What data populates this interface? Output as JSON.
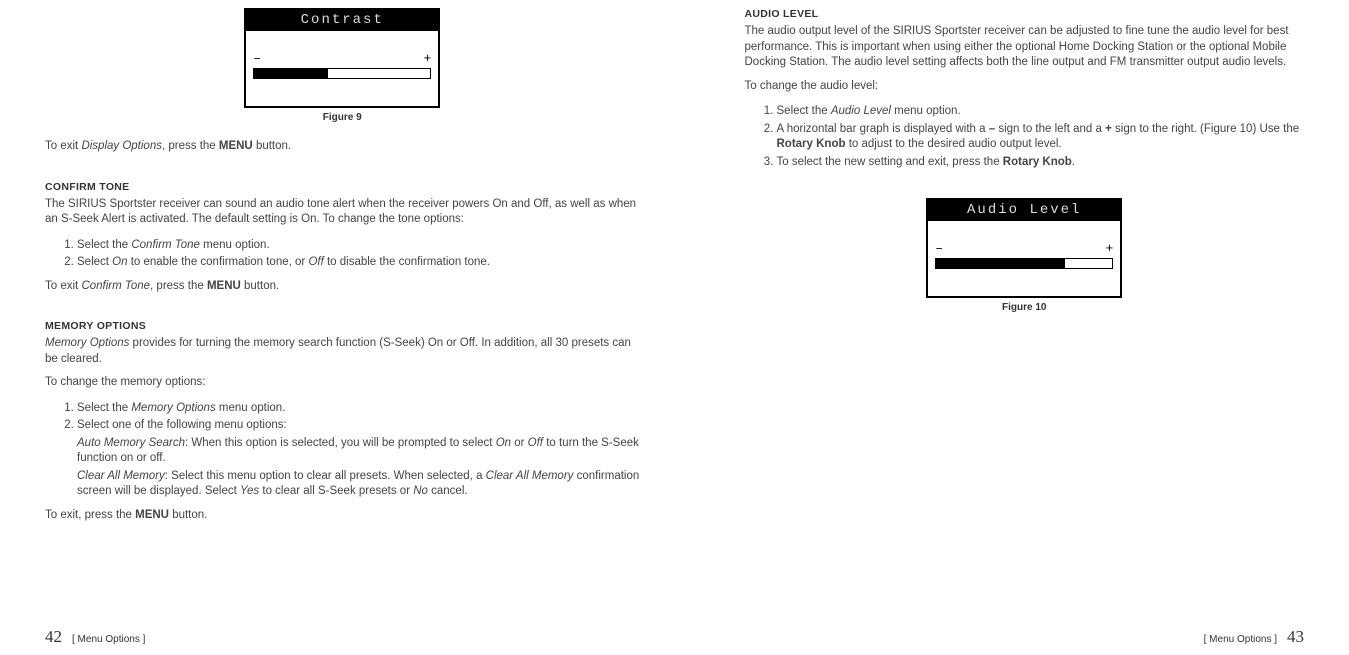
{
  "leftPage": {
    "lcd": {
      "title": "Contrast",
      "minus": "–",
      "plus": "+",
      "fillPercent": 42
    },
    "figureCaption": "Figure 9",
    "exitDisplay": {
      "prefix": "To exit ",
      "italic": "Display Options",
      "mid": ", press the ",
      "bold": "MENU",
      "suffix": " button."
    },
    "confirmTone": {
      "heading": "CONFIRM TONE",
      "intro": "The SIRIUS Sportster receiver can sound an audio tone alert when the receiver powers On and Off, as well as when an S-Seek Alert is activated. The default setting is On. To change the tone options:",
      "step1": {
        "prefix": "Select the ",
        "italic": "Confirm Tone",
        "suffix": " menu option."
      },
      "step2": {
        "prefix": "Select ",
        "italic1": "On",
        "mid": " to enable the confirmation tone, or ",
        "italic2": "Off",
        "suffix": " to disable the confirmation tone."
      },
      "exit": {
        "prefix": "To exit ",
        "italic": "Confirm Tone",
        "mid": ", press the ",
        "bold": "MENU",
        "suffix": " button."
      }
    },
    "memoryOptions": {
      "heading": "MEMORY OPTIONS",
      "intro": {
        "italic": "Memory Options",
        "text": " provides for turning the memory search function (S-Seek) On or Off. In addition, all 30 presets can be cleared."
      },
      "changeLead": "To change the memory options:",
      "step1": {
        "prefix": "Select the ",
        "italic": "Memory Options",
        "suffix": " menu option."
      },
      "step2Lead": "Select one of the following menu options:",
      "autoMem": {
        "italic": "Auto Memory Search",
        "text1": ": When this option is selected, you will be prompted to select ",
        "italicOn": "On",
        "text2": " or ",
        "italicOff": "Off",
        "text3": " to turn the S-Seek function on or off."
      },
      "clearMem": {
        "italic": "Clear All Memory",
        "text1": ": Select this menu option to clear all presets. When selected, a ",
        "italic2": "Clear All Memory",
        "text2": " confirmation screen will be displayed. Select ",
        "italicYes": "Yes",
        "text3": " to clear all S-Seek presets or ",
        "italicNo": "No",
        "text4": " cancel."
      },
      "exit": {
        "prefix": "To exit, press the ",
        "bold": "MENU",
        "suffix": " button."
      }
    },
    "footer": {
      "pageNum": "42",
      "section": "[ Menu Options ]"
    }
  },
  "rightPage": {
    "audioLevel": {
      "heading": "AUDIO LEVEL",
      "intro": "The audio output level of the SIRIUS Sportster receiver can be adjusted to fine tune the audio level for best performance. This is important when using either the optional Home Docking Station or the optional Mobile Docking Station. The audio level setting affects both the line output and FM transmitter output audio levels.",
      "changeLead": "To change the audio level:",
      "step1": {
        "prefix": "Select the ",
        "italic": "Audio Level",
        "suffix": " menu option."
      },
      "step2": {
        "text1": "A horizontal bar graph is displayed with a ",
        "bold1": "–",
        "text2": " sign to the left and a ",
        "bold2": "+",
        "text3": " sign to the right. (Figure 10) Use the ",
        "bold3": "Rotary Knob",
        "text4": " to adjust to the desired audio output level."
      },
      "step3": {
        "text1": "To select the new setting and exit, press the ",
        "bold": "Rotary Knob",
        "text2": "."
      }
    },
    "lcd": {
      "title": "Audio Level",
      "minus": "–",
      "plus": "+",
      "fillPercent": 73
    },
    "figureCaption": "Figure 10",
    "footer": {
      "section": "[ Menu Options ]",
      "pageNum": "43"
    }
  }
}
